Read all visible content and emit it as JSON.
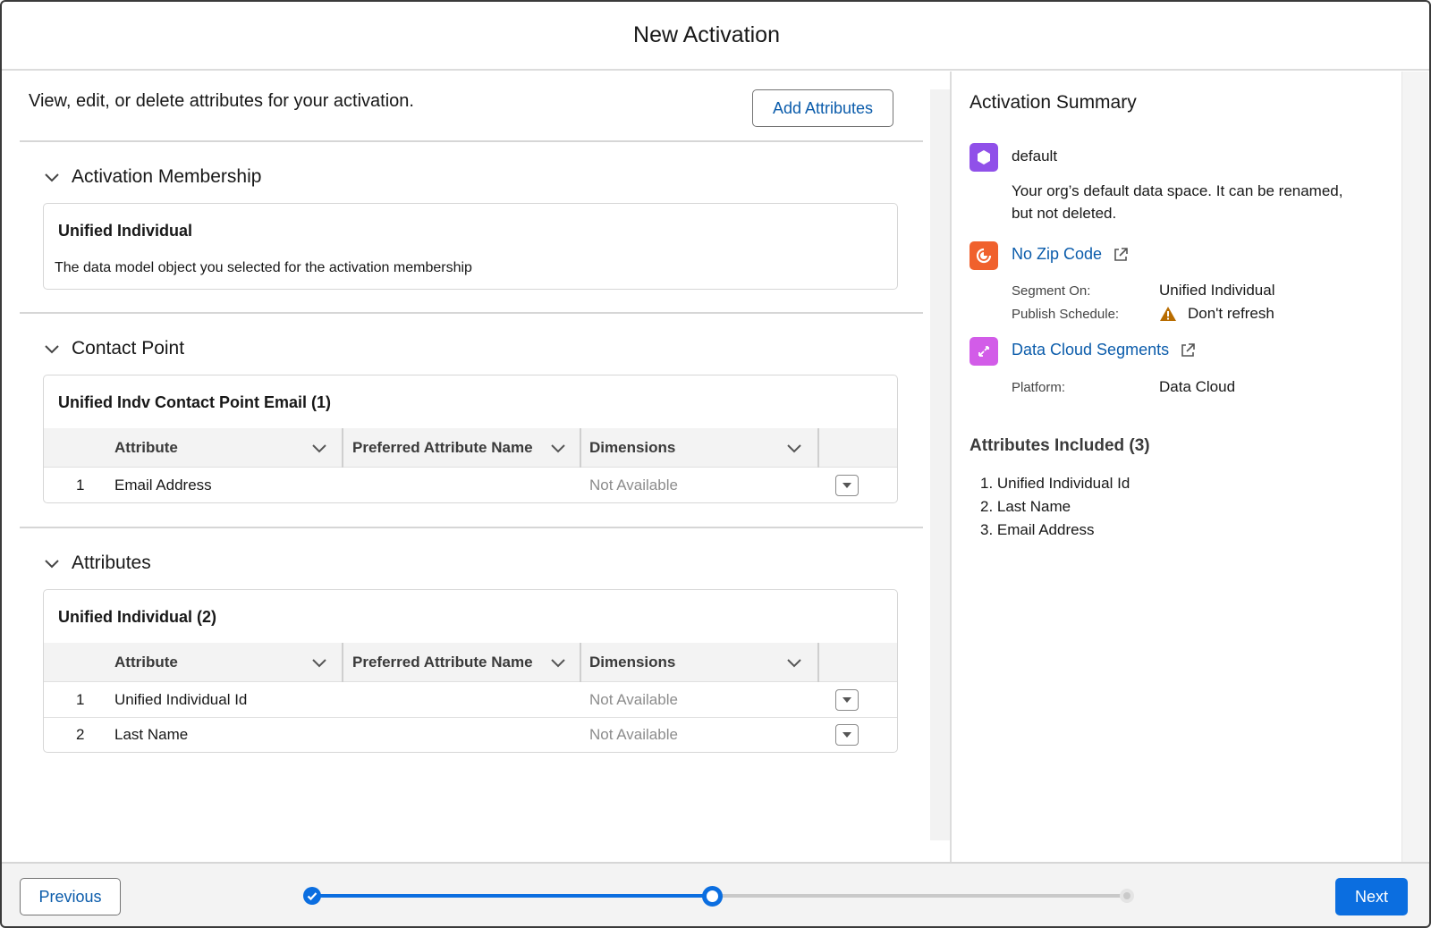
{
  "modal": {
    "title": "New Activation"
  },
  "left": {
    "intro": "View, edit, or delete attributes for your activation.",
    "add_attributes_label": "Add Attributes",
    "sections": {
      "membership": {
        "title": "Activation Membership",
        "card_title": "Unified Individual",
        "card_desc": "The data model object you selected for the activation membership"
      },
      "contact_point": {
        "title": "Contact Point",
        "card_title": "Unified Indv Contact Point Email (1)",
        "columns": [
          "Attribute",
          "Preferred Attribute Name",
          "Dimensions"
        ],
        "rows": [
          {
            "num": "1",
            "attribute": "Email Address",
            "preferred": "",
            "dimensions": "Not Available"
          }
        ]
      },
      "attributes": {
        "title": "Attributes",
        "card_title": "Unified Individual (2)",
        "columns": [
          "Attribute",
          "Preferred Attribute Name",
          "Dimensions"
        ],
        "rows": [
          {
            "num": "1",
            "attribute": "Unified Individual Id",
            "preferred": "",
            "dimensions": "Not Available"
          },
          {
            "num": "2",
            "attribute": "Last Name",
            "preferred": "",
            "dimensions": "Not Available"
          }
        ]
      }
    }
  },
  "summary": {
    "title": "Activation Summary",
    "data_space": {
      "name": "default",
      "description_line1": "Your org’s default data space. It can be renamed,",
      "description_line2": "but not deleted.",
      "icon": "data-space-icon",
      "color": "#9050e9"
    },
    "segment": {
      "name": "No Zip Code",
      "icon": "segment-icon",
      "color": "#f0612d",
      "segment_on_label": "Segment On:",
      "segment_on_value": "Unified Individual",
      "publish_label": "Publish Schedule:",
      "publish_value": "Don't refresh",
      "warning_color": "#b86c00"
    },
    "target": {
      "name": "Data Cloud Segments",
      "icon": "activation-target-icon",
      "color": "#d25ce8",
      "platform_label": "Platform:",
      "platform_value": "Data Cloud"
    },
    "attributes_title": "Attributes Included (3)",
    "attributes": [
      "1. Unified Individual Id",
      "2. Last Name",
      "3. Email Address"
    ]
  },
  "footer": {
    "previous_label": "Previous",
    "next_label": "Next",
    "progress": {
      "steps": 3,
      "completed": 1,
      "current": 2,
      "active_color": "#0b6ee0",
      "inactive_color": "#c9c9c9"
    }
  }
}
